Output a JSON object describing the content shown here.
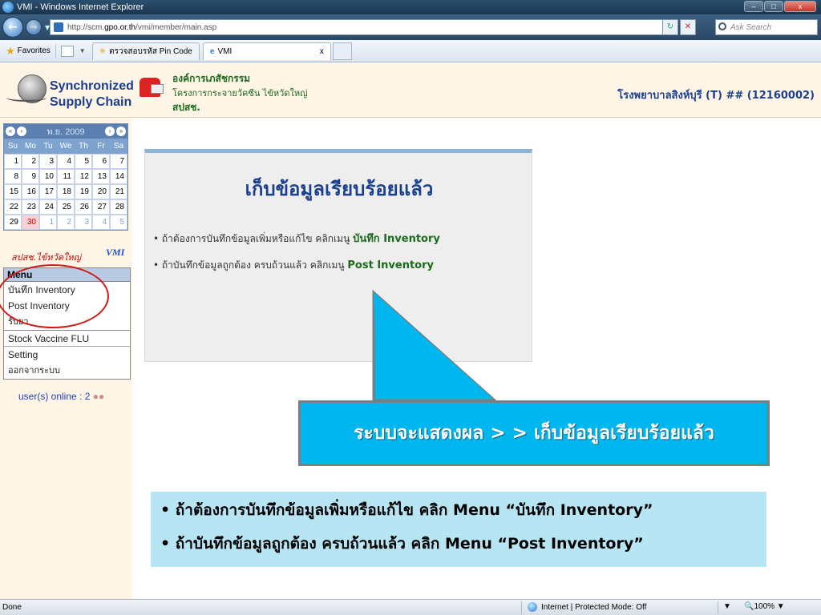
{
  "window": {
    "title": "VMI - Windows Internet Explorer",
    "minimize": "–",
    "maximize": "□",
    "close": "x"
  },
  "address": {
    "url_prefix": "http://scm.",
    "url_host": "gpo.or.th",
    "url_path": "/vmi/member/main.asp",
    "refresh_icon": "refresh-icon",
    "stop_icon": "stop-icon",
    "search_placeholder": "Ask Search"
  },
  "favorites": {
    "label": "Favorites",
    "tabs": [
      {
        "label": "ตรวจสอบรหัส Pin Code",
        "active": false
      },
      {
        "label": "VMI",
        "active": true,
        "close": "x"
      }
    ]
  },
  "header": {
    "logo_line1": "Synchronized",
    "logo_line2": "Supply Chain",
    "org_line1": "องค์การเภสัชกรรม",
    "org_line2": "โครงการกระจายวัคซีน ไข้หวัดใหญ่",
    "org_line3": "สปสช.",
    "hospital": "โรงพยาบาลสิงห์บุรี (T) ## (12160002)"
  },
  "calendar": {
    "month": "พ.ย. 2009",
    "day_headers": [
      "Su",
      "Mo",
      "Tu",
      "We",
      "Th",
      "Fr",
      "Sa"
    ],
    "rows": [
      [
        "1",
        "2",
        "3",
        "4",
        "5",
        "6",
        "7"
      ],
      [
        "8",
        "9",
        "10",
        "11",
        "12",
        "13",
        "14"
      ],
      [
        "15",
        "16",
        "17",
        "18",
        "19",
        "20",
        "21"
      ],
      [
        "22",
        "23",
        "24",
        "25",
        "26",
        "27",
        "28"
      ],
      [
        "29",
        "30",
        "1",
        "2",
        "3",
        "4",
        "5"
      ]
    ],
    "today": "30"
  },
  "sidebar": {
    "brand": "สปสช.ไข้หวัดใหญ่",
    "vmi": "VMI",
    "menu_title": "Menu",
    "items": [
      {
        "label": "บันทึก Inventory"
      },
      {
        "label": "Post Inventory"
      },
      {
        "label": "รับยา"
      },
      {
        "label": "Stock Vaccine FLU"
      },
      {
        "label": "Setting"
      },
      {
        "label": "ออกจากระบบ"
      }
    ],
    "online": "user(s) online : 2"
  },
  "panel": {
    "title": "เก็บข้อมูลเรียบร้อยแล้ว",
    "bullet1_text": "• ถ้าต้องการบันทึกข้อมูลเพิ่มหรือแก้ไข คลิกเมนู ",
    "bullet1_link": "บันทึก Inventory",
    "bullet2_text": "• ถ้าบันทึกข้อมูลถูกต้อง ครบถ้วนแล้ว คลิกเมนู ",
    "bullet2_link": "Post Inventory"
  },
  "callout": {
    "text": "ระบบจะแสดงผล > > เก็บข้อมูลเรียบร้อยแล้ว",
    "color": "#00b6ee"
  },
  "note": {
    "line1": "ถ้าต้องการบันทึกข้อมูลเพิ่มหรือแก้ไข คลิก Menu “บันทึก Inventory”",
    "line2": "ถ้าบันทึกข้อมูลถูกต้อง ครบถ้วนแล้ว คลิก Menu “Post Inventory”"
  },
  "status": {
    "done": "Done",
    "zone": "Internet | Protected Mode: Off",
    "zoom": "100%"
  }
}
